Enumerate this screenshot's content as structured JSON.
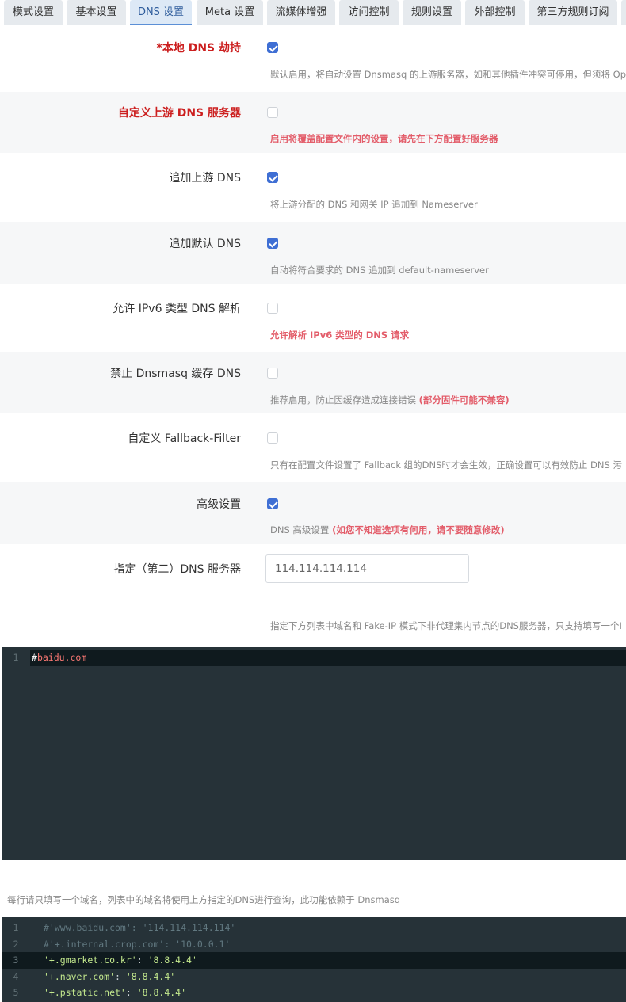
{
  "tabs": [
    {
      "label": "模式设置"
    },
    {
      "label": "基本设置"
    },
    {
      "label": "DNS 设置"
    },
    {
      "label": "Meta 设置"
    },
    {
      "label": "流媒体增强"
    },
    {
      "label": "访问控制"
    },
    {
      "label": "规则设置"
    },
    {
      "label": "外部控制"
    },
    {
      "label": "第三方规则订阅"
    }
  ],
  "active_tab": "DNS 设置",
  "settings": [
    {
      "label": "*本地 DNS 劫持",
      "checked": true,
      "desc": "默认启用，将自动设置 Dnsmasq 的上游服务器，如和其他插件冲突可停用，但须将 Op"
    },
    {
      "label": "自定义上游 DNS 服务器",
      "checked": false,
      "desc": "启用将覆盖配置文件内的设置，请先在下方配置好服务器"
    },
    {
      "label": "追加上游 DNS",
      "checked": true,
      "desc": "将上游分配的 DNS 和网关 IP 追加到 Nameserver"
    },
    {
      "label": "追加默认 DNS",
      "checked": true,
      "desc": "自动将符合要求的 DNS 追加到 default-nameserver"
    },
    {
      "label": "允许 IPv6 类型 DNS 解析",
      "checked": false,
      "desc": "允许解析 IPv6 类型的 DNS 请求"
    },
    {
      "label": "禁止 Dnsmasq 缓存 DNS",
      "checked": false,
      "desc": "推荐启用，防止因缓存造成连接错误",
      "warn": "(部分固件可能不兼容)"
    },
    {
      "label": "自定义 Fallback-Filter",
      "checked": false,
      "desc": "只有在配置文件设置了 Fallback 组的DNS时才会生效，正确设置可以有效防止 DNS 污"
    },
    {
      "label": "高级设置",
      "checked": true,
      "desc": "DNS 高级设置",
      "warn": "(如您不知道选项有何用，请不要随意修改)"
    }
  ],
  "secondary_dns": {
    "label": "指定（第二）DNS 服务器",
    "value": "114.114.114.114",
    "desc": "指定下方列表中域名和 Fake-IP 模式下非代理集内节点的DNS服务器，只支持填写一个I"
  },
  "editor1": {
    "lines": [
      {
        "num": "1",
        "hash": "#",
        "domain": "baidu.com"
      }
    ]
  },
  "editor1_note": "每行请只填写一个域名，列表中的域名将使用上方指定的DNS进行查询，此功能依赖于 Dnsmasq",
  "editor2": {
    "lines": [
      {
        "num": "1",
        "text": "#'www.baidu.com': '114.114.114.114'"
      },
      {
        "num": "2",
        "text": "#'+.internal.crop.com': '10.0.0.1'"
      },
      {
        "num": "3",
        "key": "'+.gmarket.co.kr'",
        "sep": ": ",
        "val": "'8.8.4.4'"
      },
      {
        "num": "4",
        "key": "'+.naver.com'",
        "sep": ": ",
        "val": "'8.8.4.4'"
      },
      {
        "num": "5",
        "key": "'+.pstatic.net'",
        "sep": ": ",
        "val": "'8.8.4.4'"
      }
    ]
  }
}
